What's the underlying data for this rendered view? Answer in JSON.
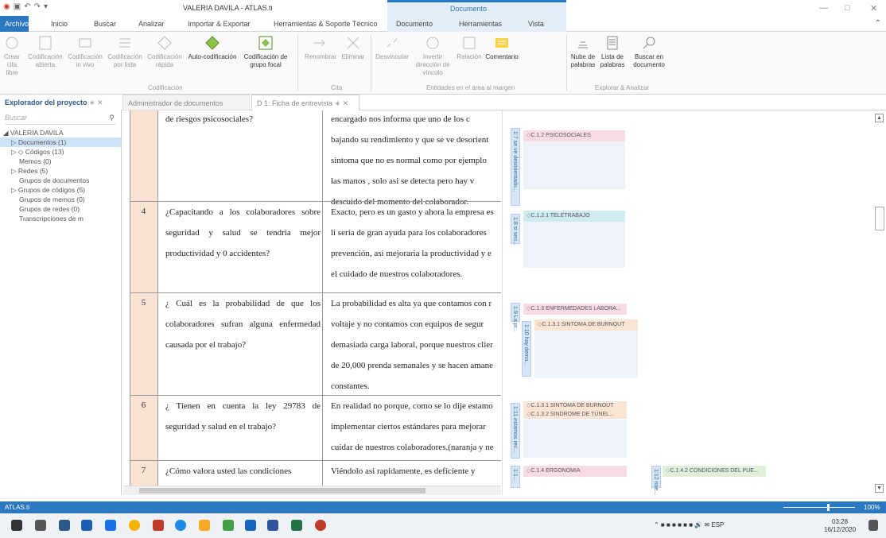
{
  "window": {
    "title": "VALERIA DAVILA - ATLAS.ti",
    "context_title": "Documento"
  },
  "tabs": [
    "Archivo",
    "Inicio",
    "Buscar",
    "Analizar",
    "Importar & Exportar",
    "Herramientas & Soporte Técnico",
    "Documento",
    "Herramientas",
    "Vista"
  ],
  "ribbon": {
    "buttons": [
      "Crear cita libre",
      "Codificación abierta",
      "Codificación in vivo",
      "Codificación por lista",
      "Codificación rápida",
      "Auto-codificación",
      "Codificación de grupo focal",
      "Renombrar",
      "Eliminar",
      "Desvincular",
      "Invertir dirección de vínculo",
      "Relación",
      "Comentario",
      "Nube de palabras",
      "Lista de palabras",
      "Buscar en documento"
    ],
    "groups": [
      "Codificación",
      "Cita",
      "Entidades en el área al margen",
      "Explorar & Analizar"
    ]
  },
  "doc_tabs": {
    "project": "Explorador del proyecto",
    "manager": "Administrador de documentos",
    "document": "D 1: Ficha de entrevista"
  },
  "nav": {
    "search_placeholder": "Buscar",
    "items": [
      "VALERIA DAVILA",
      "Documentos (1)",
      "Códigos (13)",
      "Memos (0)",
      "Redes (5)",
      "Grupos de documentos",
      "Grupos de códigos (5)",
      "Grupos de memos (0)",
      "Grupos de redes (0)",
      "Transcripciones de m"
    ]
  },
  "rows": [
    {
      "num": "",
      "question": "de riesgos psicosociales?",
      "answer": [
        "encargado nos informa que uno de los c",
        "bajando su rendimiento y que se ve desorient",
        "sintoma que no es normal como por ejemplo",
        "las manos , solo asi se detecta pero hay v",
        "descuido del momento del colaborador."
      ]
    },
    {
      "num": "4",
      "question": "¿Capacitando a los colaboradores sobre seguridad y salud se tendria mejor productividad y 0 accidentes?",
      "answer": [
        "Exacto, pero es un gasto y ahora la empresa es",
        "li seria de gran ayuda para los colaboradores",
        "prevención, asi mejoraria la productividad y e",
        "el cuidado de nuestros colaboradores."
      ]
    },
    {
      "num": "5",
      "question": "¿ Cuál es la probabilidad de que los colaboradores sufran alguna enfermedad causada por el trabajo?",
      "answer": [
        "La probabilidad es alta ya que contamos con r",
        "voltaje y no contamos con equipos de segur",
        "demasiada carga laboral, porque nuestros clier",
        "de 20,000 prenda semanales y se hacen amane",
        "constantes."
      ]
    },
    {
      "num": "6",
      "question": "¿ Tienen en cuenta la ley 29783 de seguridad y salud en el trabajo?",
      "answer": [
        "En realidad no porque, como se lo dije estamo",
        "implementar ciertos estándares para mejorar",
        "cuidar de nuestros colaboradores.(naranja y ne"
      ]
    },
    {
      "num": "7",
      "question": "¿Cómo valora usted las condiciones",
      "answer": [
        "Viéndolo asi rapidamente, es deficiente y"
      ]
    }
  ],
  "margin": {
    "quotes": [
      "1:7 se ve desorientado...",
      "1:8 si seri...",
      "1:9 La pr...",
      "1:10 hay dema...",
      "1:11 estamos rec...",
      "1:1...",
      "1:12 nue..."
    ],
    "codes": [
      "C.1.2  PSICOSOCIALES",
      "C.1.2.1 TELETRABAJO",
      "C.1.3 ENFERMEDADES LABORA...",
      "C.1.3.1 SINTOMA DE BURNOUT",
      "C.1.3.1 SINTOMA DE BURNOUT",
      "C.1.3.2 SINDROME DE TÚNEL...",
      "C.1.4 ERGONOMIA",
      "C.1.4.2 CONDICIONES DEL PUE..."
    ]
  },
  "status": {
    "app": "ATLAS.ti",
    "zoom": "100%"
  },
  "taskbar": {
    "lang": "ESP",
    "time": "03:28",
    "date": "16/12/2020"
  },
  "colors": {
    "accent": "#2b78c2",
    "numcol": "#fbe3d4"
  }
}
